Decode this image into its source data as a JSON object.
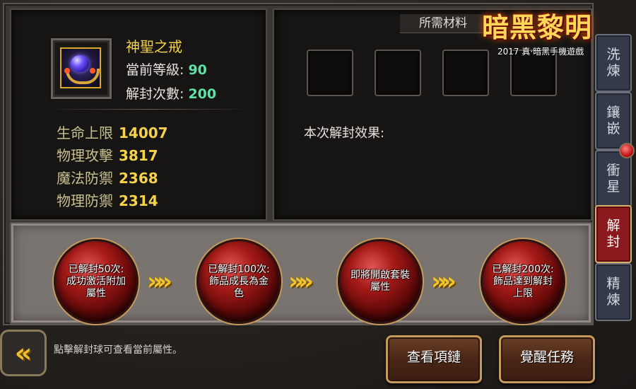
{
  "item": {
    "name": "神聖之戒",
    "level_label": "當前等級:",
    "level_value": "90",
    "unseal_label": "解封次數:",
    "unseal_value": "200",
    "attributes": [
      {
        "label": "生命上限",
        "value": "14007"
      },
      {
        "label": "物理攻擊",
        "value": "3817"
      },
      {
        "label": "魔法防禦",
        "value": "2368"
      },
      {
        "label": "物理防禦",
        "value": "2314"
      }
    ]
  },
  "materials": {
    "header": "所需材料"
  },
  "effect": {
    "label": "本次解封效果:"
  },
  "logo": {
    "title": "暗黑黎明",
    "subtitle": "2017 真·暗黑手機遊戲"
  },
  "milestones": [
    {
      "text": "已解封50次:成功激活附加屬性"
    },
    {
      "text": "已解封100次:飾品成長為金色"
    },
    {
      "text": "即將開啟套裝屬性"
    },
    {
      "text": "已解封200次:飾品達到解封上限"
    }
  ],
  "tabs": [
    {
      "label": "洗煉",
      "active": false
    },
    {
      "label": "鑲嵌",
      "active": false
    },
    {
      "label": "衝星",
      "active": false
    },
    {
      "label": "解封",
      "active": true
    },
    {
      "label": "精煉",
      "active": false
    }
  ],
  "footer": {
    "back_icon": "arrow-left-icon",
    "hint": "點擊解封球可查看當前屬性。",
    "view_necklace": "查看項鏈",
    "awaken_quest": "覺醒任務"
  },
  "colors": {
    "gold": "#f4d24a",
    "green": "#5fe0a5",
    "active_tab": "#8a1a1d"
  }
}
